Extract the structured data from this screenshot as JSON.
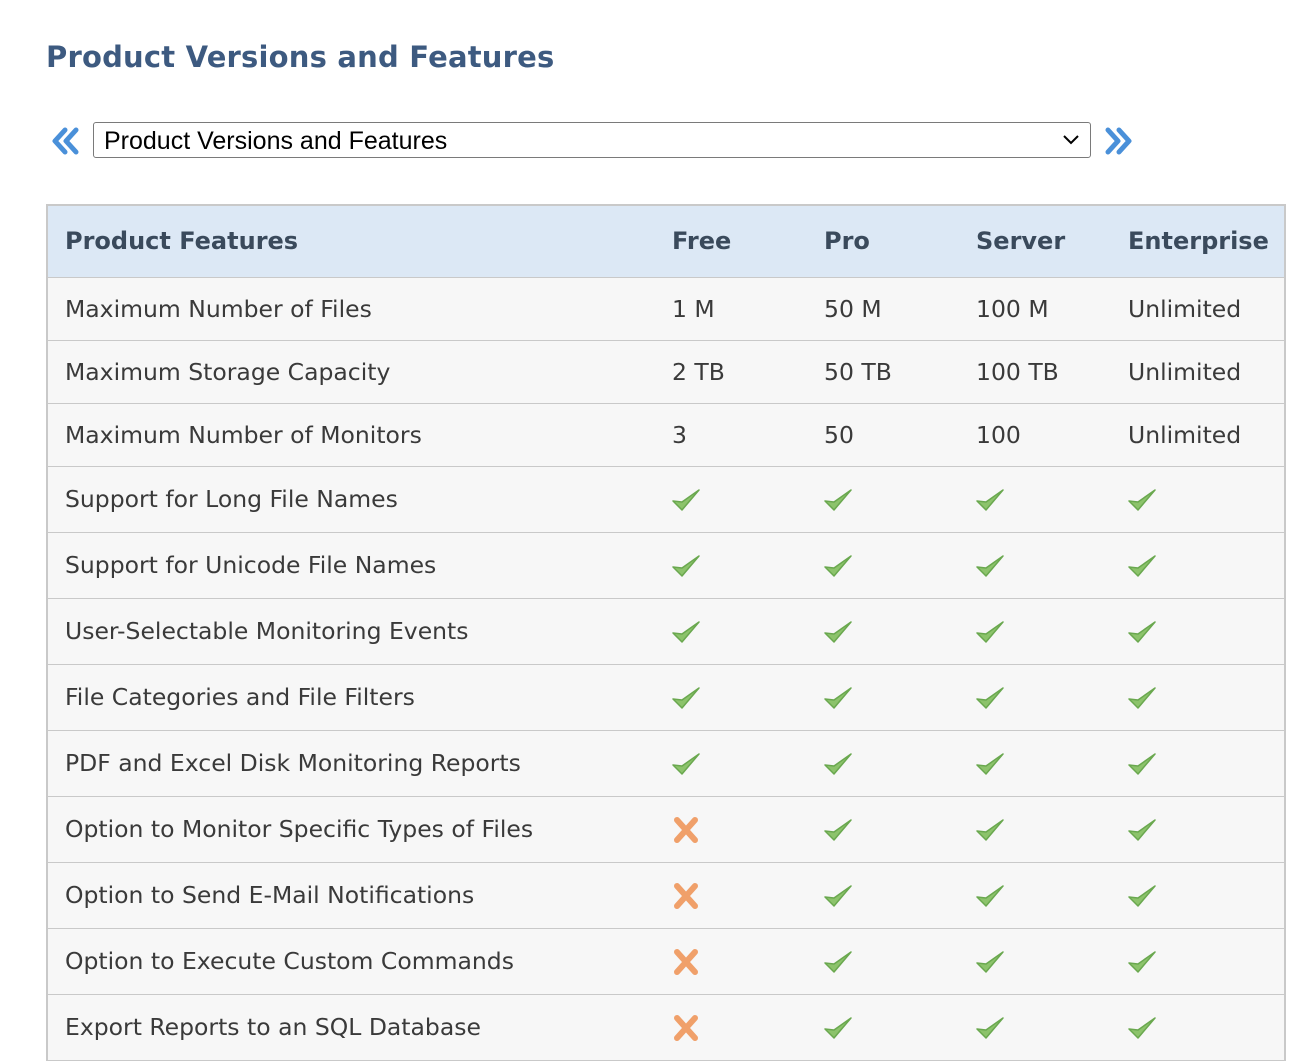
{
  "page": {
    "title": "Product Versions and Features"
  },
  "nav": {
    "selected": "Product Versions and Features",
    "prev_icon": "double-chevron-left-icon",
    "next_icon": "double-chevron-right-icon",
    "accent_color": "#4a90d9"
  },
  "table": {
    "headers": [
      "Product Features",
      "Free",
      "Pro",
      "Server",
      "Enterprise"
    ],
    "rows": [
      {
        "feature": "Maximum Number of Files",
        "values": [
          "1 M",
          "50 M",
          "100 M",
          "Unlimited"
        ]
      },
      {
        "feature": "Maximum Storage Capacity",
        "values": [
          "2 TB",
          "50 TB",
          "100 TB",
          "Unlimited"
        ]
      },
      {
        "feature": "Maximum Number of Monitors",
        "values": [
          "3",
          "50",
          "100",
          "Unlimited"
        ]
      },
      {
        "feature": "Support for Long File Names",
        "values": [
          true,
          true,
          true,
          true
        ]
      },
      {
        "feature": "Support for Unicode File Names",
        "values": [
          true,
          true,
          true,
          true
        ]
      },
      {
        "feature": "User-Selectable Monitoring Events",
        "values": [
          true,
          true,
          true,
          true
        ]
      },
      {
        "feature": "File Categories and File Filters",
        "values": [
          true,
          true,
          true,
          true
        ]
      },
      {
        "feature": "PDF and Excel Disk Monitoring Reports",
        "values": [
          true,
          true,
          true,
          true
        ]
      },
      {
        "feature": "Option to Monitor Specific Types of Files",
        "values": [
          false,
          true,
          true,
          true
        ]
      },
      {
        "feature": "Option to Send E-Mail Notifications",
        "values": [
          false,
          true,
          true,
          true
        ]
      },
      {
        "feature": "Option to Execute Custom Commands",
        "values": [
          false,
          true,
          true,
          true
        ]
      },
      {
        "feature": "Export Reports to an SQL Database",
        "values": [
          false,
          true,
          true,
          true
        ]
      }
    ],
    "icons": {
      "yes": "check-icon",
      "no": "cross-icon"
    },
    "colors": {
      "check": "#8cc36b",
      "cross": "#f0a06a",
      "header_bg": "#dce8f5"
    }
  }
}
